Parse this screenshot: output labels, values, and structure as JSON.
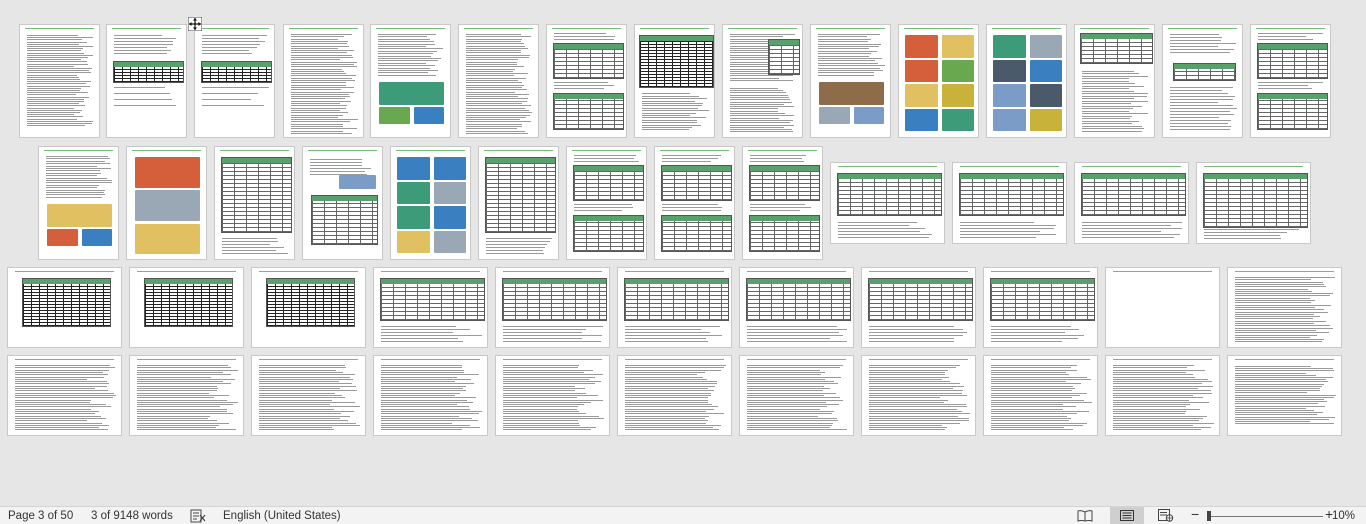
{
  "status_bar": {
    "page_info": "Page 3 of 50",
    "word_count": "3 of 9148 words",
    "language": "English (United States)",
    "zoom_minus": "−",
    "zoom_plus": "+",
    "zoom_level": "10%",
    "zoom_value": 10,
    "icons": [
      "proofing-icon",
      "read-mode-icon",
      "print-layout-icon",
      "web-layout-icon"
    ]
  },
  "document": {
    "total_pages": 50,
    "current_page": 3
  },
  "colors": {
    "header_rule": "#6fbf73",
    "table_header": "#5aa06c",
    "status_bg": "#f3f3f3",
    "canvas_bg": "#e6e6e6"
  }
}
